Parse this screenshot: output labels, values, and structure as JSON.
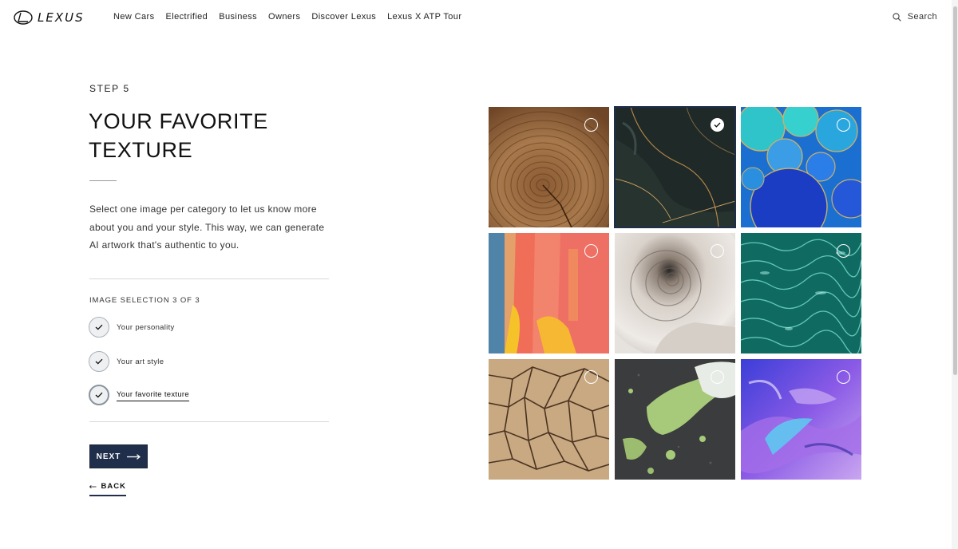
{
  "header": {
    "logo_text": "LEXUS",
    "nav": [
      "New Cars",
      "Electrified",
      "Business",
      "Owners",
      "Discover Lexus",
      "Lexus X ATP Tour"
    ],
    "search_label": "Search"
  },
  "step": {
    "label": "STEP 5",
    "title": "YOUR FAVORITE TEXTURE",
    "description": "Select one image per category to let us know more about you and your style. This way, we can generate AI artwork that's authentic to you."
  },
  "selection": {
    "label": "IMAGE SELECTION 3 OF 3",
    "items": [
      {
        "label": "Your personality",
        "completed": true
      },
      {
        "label": "Your art style",
        "completed": true
      },
      {
        "label": "Your favorite texture",
        "completed": true,
        "current": true
      }
    ]
  },
  "actions": {
    "next_label": "NEXT",
    "back_label": "BACK"
  },
  "grid": {
    "tiles": [
      {
        "name": "wood-rings",
        "selected": false
      },
      {
        "name": "dark-marble",
        "selected": true
      },
      {
        "name": "blue-bubbles",
        "selected": false
      },
      {
        "name": "orange-paint",
        "selected": false
      },
      {
        "name": "nautilus-shell",
        "selected": false
      },
      {
        "name": "teal-water",
        "selected": false
      },
      {
        "name": "cracked-earth",
        "selected": false
      },
      {
        "name": "green-splatter",
        "selected": false
      },
      {
        "name": "purple-fluid",
        "selected": false
      }
    ]
  },
  "colors": {
    "accent": "#1f2e4a",
    "text": "#111111",
    "rule": "#d8d8d8"
  }
}
